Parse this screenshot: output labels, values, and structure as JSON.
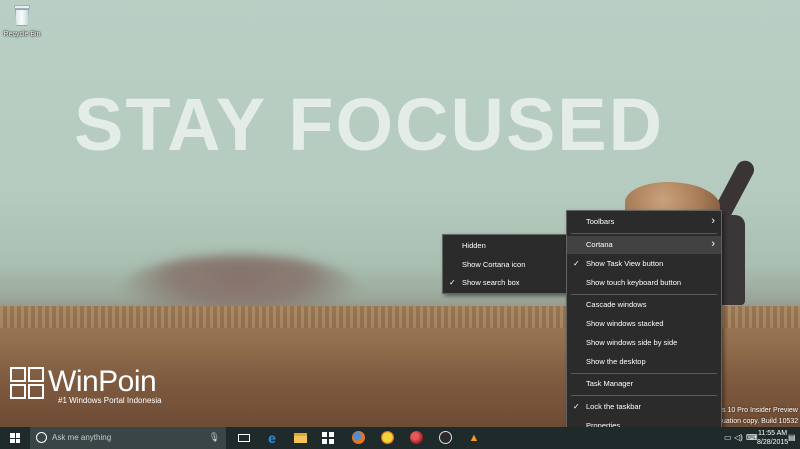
{
  "desktop": {
    "slogan": "STAY FOCUSED",
    "icons": [
      {
        "label": "Recycle Bin",
        "icon": "recycle-bin-icon"
      }
    ],
    "watermark": {
      "name": "WinPoin",
      "tagline": "#1 Windows Portal Indonesia"
    },
    "build_info": {
      "line1": "s 10 Pro Insider Preview",
      "line2": "uation copy. Build 10532"
    }
  },
  "context_menu": {
    "items": {
      "toolbars": "Toolbars",
      "cortana": "Cortana",
      "show_task_view": "Show Task View button",
      "show_touch_keyboard": "Show touch keyboard button",
      "cascade": "Cascade windows",
      "stacked": "Show windows stacked",
      "side_by_side": "Show windows side by side",
      "show_desktop": "Show the desktop",
      "task_manager": "Task Manager",
      "lock_taskbar": "Lock the taskbar",
      "properties": "Properties"
    },
    "checked": [
      "show_task_view",
      "lock_taskbar"
    ],
    "active": "cortana"
  },
  "cortana_submenu": {
    "items": {
      "hidden": "Hidden",
      "show_icon": "Show Cortana icon",
      "show_search_box": "Show search box"
    },
    "checked": "show_search_box"
  },
  "taskbar": {
    "search_placeholder": "Ask me anything",
    "pinned": [
      "task-view-icon",
      "edge-icon",
      "file-explorer-icon",
      "store-icon",
      "firefox-icon",
      "paint-icon",
      "app-red-icon",
      "app-dark-icon",
      "vlc-icon"
    ],
    "clock": {
      "time": "11:55 AM",
      "date": "8/28/2015"
    }
  },
  "colors": {
    "taskbar": "#1f2a2a",
    "menu_bg": "#2b2b2b",
    "menu_active": "#424242",
    "edge_blue": "#2a8fe0"
  }
}
